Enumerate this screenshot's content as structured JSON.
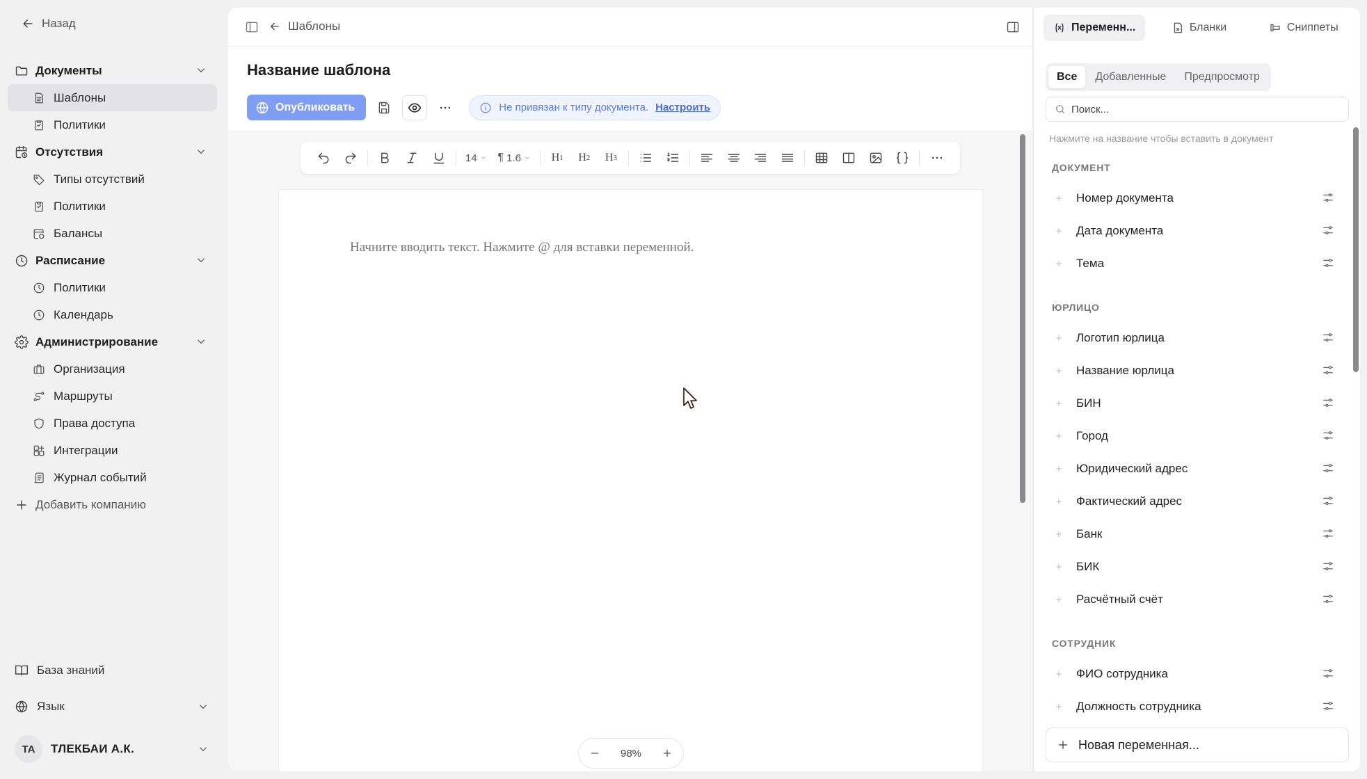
{
  "sidebar": {
    "back_label": "Назад",
    "sections": [
      {
        "label": "Документы",
        "icon": "folder-icon",
        "items": [
          {
            "label": "Шаблоны",
            "icon": "document-icon",
            "active": true
          },
          {
            "label": "Политики",
            "icon": "clipboard-icon",
            "active": false
          }
        ]
      },
      {
        "label": "Отсутствия",
        "icon": "calendar-clock-icon",
        "items": [
          {
            "label": "Типы отсутствий",
            "icon": "tag-icon",
            "active": false
          },
          {
            "label": "Политики",
            "icon": "clipboard-icon",
            "active": false
          },
          {
            "label": "Балансы",
            "icon": "calendar-clock-icon",
            "active": false
          }
        ]
      },
      {
        "label": "Расписание",
        "icon": "clock-icon",
        "items": [
          {
            "label": "Политики",
            "icon": "clock-icon",
            "active": false
          },
          {
            "label": "Календарь",
            "icon": "clock-icon",
            "active": false
          }
        ]
      },
      {
        "label": "Администрирование",
        "icon": "gear-icon",
        "items": [
          {
            "label": "Организация",
            "icon": "briefcase-icon",
            "active": false
          },
          {
            "label": "Маршруты",
            "icon": "route-icon",
            "active": false
          },
          {
            "label": "Права доступа",
            "icon": "shield-icon",
            "active": false
          },
          {
            "label": "Интеграции",
            "icon": "grid-plus-icon",
            "active": false
          },
          {
            "label": "Журнал событий",
            "icon": "scroll-icon",
            "active": false
          }
        ]
      }
    ],
    "add_company": "Добавить компанию",
    "knowledge_base": "База знаний",
    "language": "Язык",
    "user": {
      "initials": "ТА",
      "name": "ТЛЕКБАИ А.К."
    }
  },
  "header": {
    "breadcrumb": "Шаблоны",
    "title": "Название шаблона",
    "publish_label": "Опубликовать",
    "notice_text": "Не привязан к типу документа.",
    "notice_link": "Настроить"
  },
  "toolbar": {
    "font_size": "14",
    "line_height": "1.6",
    "h1": "H",
    "h2": "H",
    "h3": "H",
    "h1_sub": "1",
    "h2_sub": "2",
    "h3_sub": "3"
  },
  "editor": {
    "placeholder": "Начните вводить текст. Нажмите @ для вставки переменной.",
    "zoom": "98%"
  },
  "right_panel": {
    "tabs": [
      {
        "label": "Переменн...",
        "icon": "variable-icon",
        "active": true
      },
      {
        "label": "Бланки",
        "icon": "document-icon",
        "active": false
      },
      {
        "label": "Сниппеты",
        "icon": "snippet-icon",
        "active": false
      }
    ],
    "subtabs": [
      {
        "label": "Все",
        "active": true
      },
      {
        "label": "Добавленные",
        "active": false
      },
      {
        "label": "Предпросмотр",
        "active": false
      }
    ],
    "search_placeholder": "Поиск...",
    "hint": "Нажмите на название чтобы вставить в документ",
    "groups": [
      {
        "title": "ДОКУМЕНТ",
        "items": [
          "Номер документа",
          "Дата документа",
          "Тема"
        ]
      },
      {
        "title": "ЮРЛИЦО",
        "items": [
          "Логотип юрлица",
          "Название юрлица",
          "БИН",
          "Город",
          "Юридический адрес",
          "Фактический адрес",
          "Банк",
          "БИК",
          "Расчётный счёт"
        ]
      },
      {
        "title": "СОТРУДНИК",
        "items": [
          "ФИО сотрудника",
          "Должность сотрудника"
        ]
      }
    ],
    "new_variable": "Новая переменная..."
  }
}
